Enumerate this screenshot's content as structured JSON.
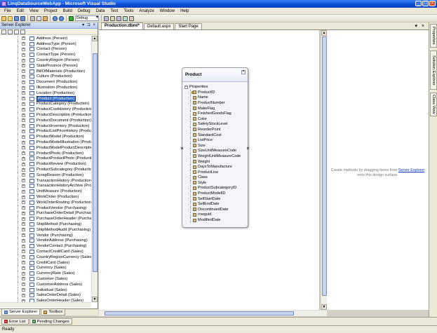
{
  "window": {
    "title": "LinqDataSourceWebApp - Microsoft Visual Studio",
    "minimize": "_",
    "maximize": "□",
    "close": "×"
  },
  "menu": [
    "File",
    "Edit",
    "View",
    "Project",
    "Build",
    "Debug",
    "Data",
    "Test",
    "Tools",
    "Analyze",
    "Window",
    "Help"
  ],
  "toolbar": {
    "config_value": "Debug"
  },
  "server_explorer": {
    "title": "Server Explorer",
    "controls": "▾ ⊐ ×",
    "tables": [
      "Address (Person)",
      "AddressType (Person)",
      "Contact (Person)",
      "ContactType (Person)",
      "CountryRegion (Person)",
      "StateProvince (Person)",
      "BillOfMaterials (Production)",
      "Culture (Production)",
      "Document (Production)",
      "Illustration (Production)",
      "Location (Production)",
      "Product (Production)",
      "ProductCategory (Production)",
      "ProductCostHistory (Production)",
      "ProductDescription (Production)",
      "ProductDocument (Production)",
      "ProductInventory (Production)",
      "ProductListPriceHistory (Production)",
      "ProductModel (Production)",
      "ProductModelIllustration (Production)",
      "ProductModelProductDescription (Production)",
      "ProductPhoto (Production)",
      "ProductProductPhoto (Production)",
      "ProductReview (Production)",
      "ProductSubcategory (Production)",
      "ScrapReason (Production)",
      "TransactionHistory (Production)",
      "TransactionHistoryArchive (Production)",
      "UnitMeasure (Production)",
      "WorkOrder (Production)",
      "WorkOrderRouting (Production)",
      "ProductVendor (Purchasing)",
      "PurchaseOrderDetail (Purchasing)",
      "PurchaseOrderHeader (Purchasing)",
      "ShipMethod (Purchasing)",
      "ShipMethodAudit (Purchasing)",
      "Vendor (Purchasing)",
      "VendorAddress (Purchasing)",
      "VendorContact (Purchasing)",
      "ContactCreditCard (Sales)",
      "CountryRegionCurrency (Sales)",
      "CreditCard (Sales)",
      "Currency (Sales)",
      "CurrencyRate (Sales)",
      "Customer (Sales)",
      "CustomerAddress (Sales)",
      "Individual (Sales)",
      "SalesOrderDetail (Sales)",
      "SalesOrderHeader (Sales)"
    ],
    "selected_index": 11,
    "expander": "+"
  },
  "panel_tabs": [
    "Server Explorer",
    "Toolbox"
  ],
  "bottom_tabs": [
    "Error List",
    "Pending Changes"
  ],
  "status": "Ready",
  "doc_tabs": [
    "Production.dbml*",
    "Default.aspx",
    "Start Page"
  ],
  "doc_close": "▾ ×",
  "entity": {
    "name": "Product",
    "collapse": "^",
    "section": "Properties",
    "section_expander": "−",
    "properties": [
      "ProductID",
      "Name",
      "ProductNumber",
      "MakeFlag",
      "FinishedGoodsFlag",
      "Color",
      "SafetyStockLevel",
      "ReorderPoint",
      "StandardCost",
      "ListPrice",
      "Size",
      "SizeUnitMeasureCode",
      "WeightUnitMeasureCode",
      "Weight",
      "DaysToManufacture",
      "ProductLine",
      "Class",
      "Style",
      "ProductSubcategoryID",
      "ProductModelID",
      "SellStartDate",
      "SellEndDate",
      "DiscontinuedDate",
      "rowguid",
      "ModifiedDate"
    ]
  },
  "methods_pane": {
    "hint_before": "Create methods by dragging items from ",
    "hint_link": "Server Explorer",
    "hint_after": " onto this design surface."
  },
  "side_tabs": [
    "Properties",
    "Solution Explorer",
    "Class View"
  ]
}
